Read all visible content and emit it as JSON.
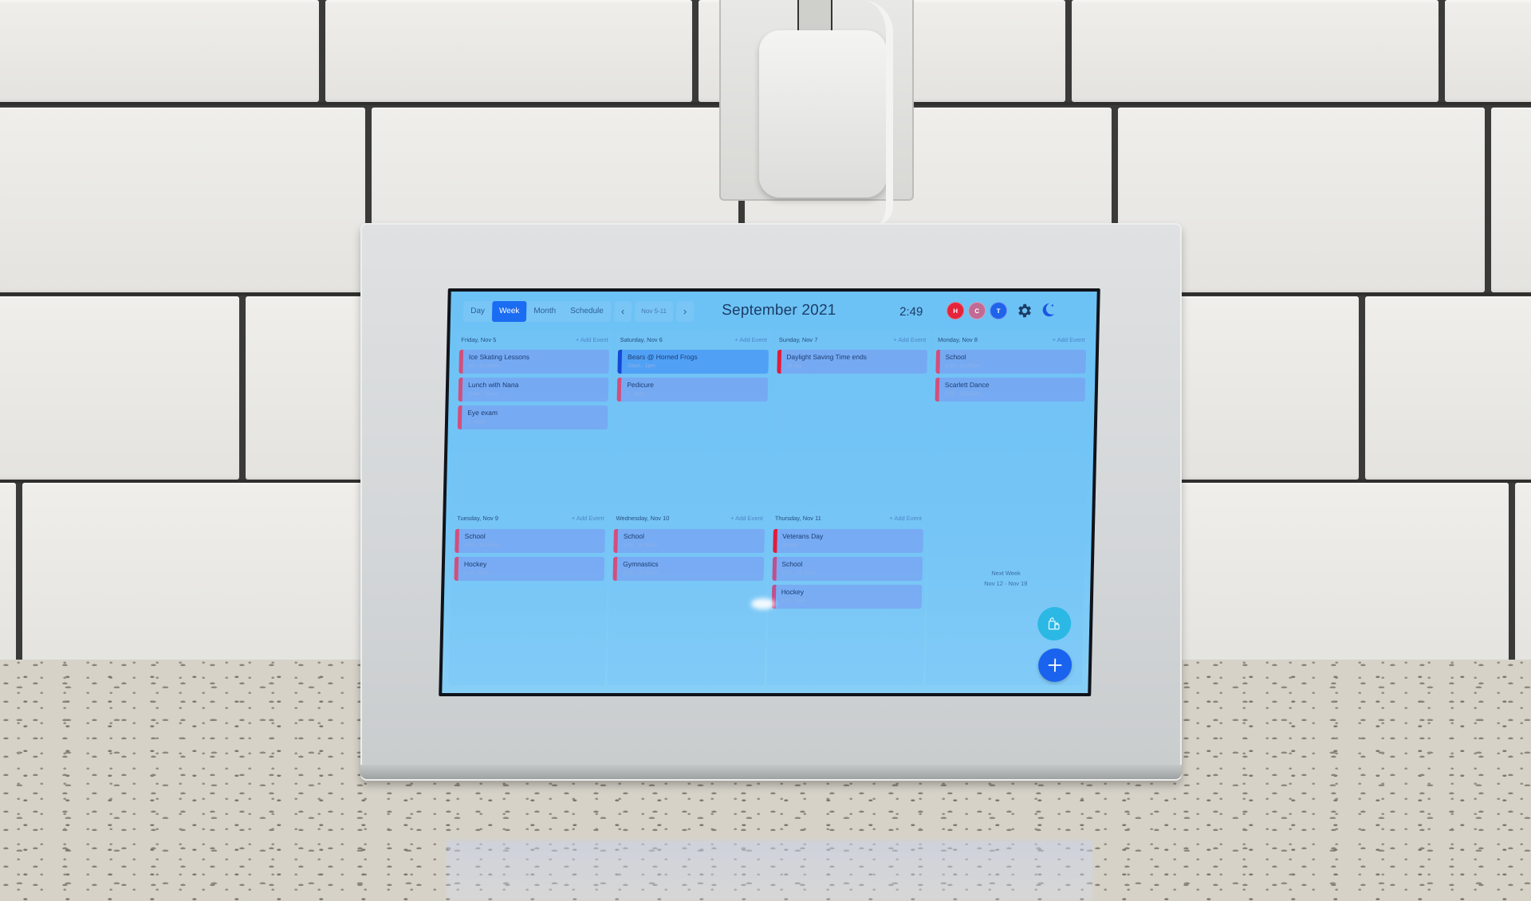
{
  "header": {
    "view_tabs": [
      {
        "label": "Day",
        "active": false
      },
      {
        "label": "Week",
        "active": true
      },
      {
        "label": "Month",
        "active": false
      },
      {
        "label": "Schedule",
        "active": false
      }
    ],
    "prev_icon": "chevron-left-icon",
    "next_icon": "chevron-right-icon",
    "range_label": "Nov 5-11",
    "month_title": "September 2021",
    "clock": "2:49",
    "profiles": [
      {
        "initial": "H",
        "color": "#e5243b"
      },
      {
        "initial": "C",
        "color": "#c16a94"
      },
      {
        "initial": "T",
        "color": "#1f63ea"
      }
    ],
    "settings_icon": "gear-icon",
    "night_mode_icon": "moon-icon"
  },
  "add_event_label": "+ Add Event",
  "days": [
    {
      "name": "Friday, Nov 5",
      "events": [
        {
          "title": "Ice Skating Lessons",
          "time": "10 - 10:30am",
          "color": "#d24f7c"
        },
        {
          "title": "Lunch with Nana",
          "time": "11am - 12pm",
          "color": "#d24f7c"
        },
        {
          "title": "Eye exam",
          "time": "3 - 4pm",
          "color": "#d24f7c"
        }
      ]
    },
    {
      "name": "Saturday, Nov 6",
      "events": [
        {
          "title": "Bears @ Horned Frogs",
          "time": "10am - 1pm",
          "color": "#1448d8",
          "highlight": true
        },
        {
          "title": "Pedicure",
          "time": "3 - 4pm",
          "color": "#d24f7c"
        }
      ]
    },
    {
      "name": "Sunday, Nov 7",
      "events": [
        {
          "title": "Daylight Saving Time ends",
          "time": "All day",
          "color": "#e11c3a"
        }
      ]
    },
    {
      "name": "Monday, Nov 8",
      "events": [
        {
          "title": "School",
          "time": "8:30 - 11:30am",
          "color": "#d24f7c"
        },
        {
          "title": "Scarlett Dance",
          "time": "9:30 - 10:15am",
          "color": "#d24f7c"
        }
      ]
    },
    {
      "name": "Tuesday, Nov 9",
      "events": [
        {
          "title": "School",
          "time": "8:30 - 11:30am",
          "color": "#d24f7c"
        },
        {
          "title": "Hockey",
          "time": "4:15 - 5pm",
          "color": "#d24f7c"
        }
      ]
    },
    {
      "name": "Wednesday, Nov 10",
      "events": [
        {
          "title": "School",
          "time": "8:30 - 11:30am",
          "color": "#d24f7c"
        },
        {
          "title": "Gymnastics",
          "time": "9:45 - 10:30am",
          "color": "#d24f7c"
        }
      ]
    },
    {
      "name": "Thursday, Nov 11",
      "events": [
        {
          "title": "Veterans Day",
          "time": "All day",
          "color": "#e11c3a"
        },
        {
          "title": "School",
          "time": "8:30 - 11:30am",
          "color": "#c04f8c"
        },
        {
          "title": "Hockey",
          "time": "4:15 - 5pm",
          "color": "#c04f8c"
        }
      ]
    }
  ],
  "next_week": {
    "label": "Next Week",
    "range": "Nov 12 - Nov 19"
  },
  "fabs": {
    "chores_icon": "chores-icon",
    "add_icon": "plus-icon"
  }
}
